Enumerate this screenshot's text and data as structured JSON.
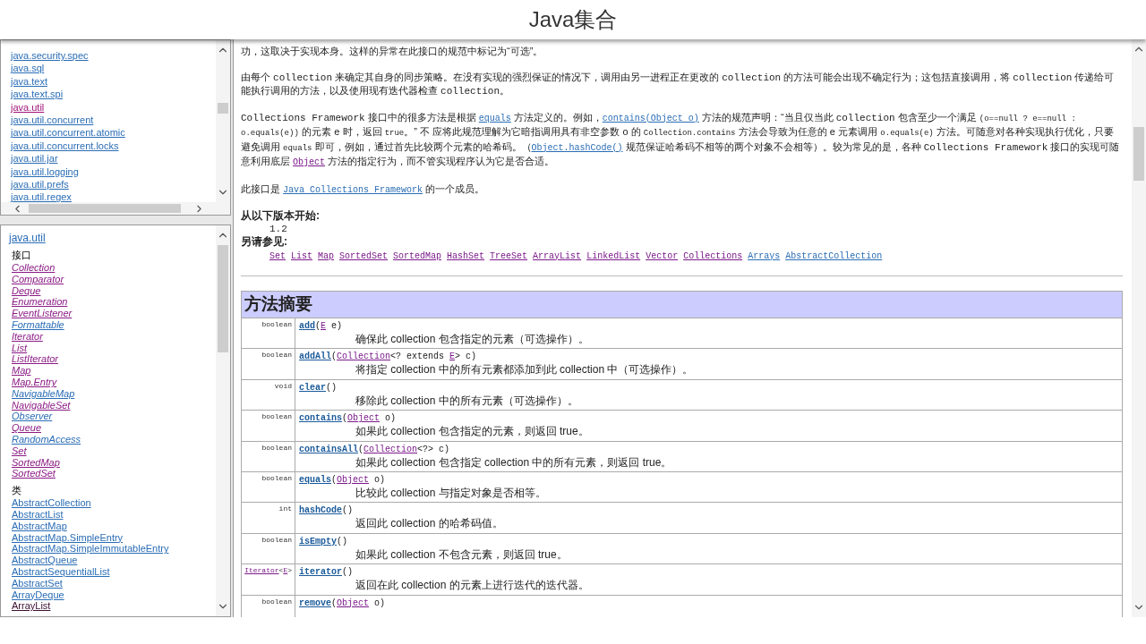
{
  "title": "Java集合",
  "packages": [
    {
      "label": "java.security.spec",
      "visited": false
    },
    {
      "label": "java.sql",
      "visited": false
    },
    {
      "label": "java.text",
      "visited": false
    },
    {
      "label": "java.text.spi",
      "visited": false
    },
    {
      "label": "java.util",
      "visited": true
    },
    {
      "label": "java.util.concurrent",
      "visited": false
    },
    {
      "label": "java.util.concurrent.atomic",
      "visited": false
    },
    {
      "label": "java.util.concurrent.locks",
      "visited": false
    },
    {
      "label": "java.util.jar",
      "visited": false
    },
    {
      "label": "java.util.logging",
      "visited": false
    },
    {
      "label": "java.util.prefs",
      "visited": false
    },
    {
      "label": "java.util.regex",
      "visited": false
    }
  ],
  "package_title": "java.util",
  "groups": [
    {
      "heading": "接口",
      "italic": true,
      "items": [
        {
          "label": "Collection",
          "visited": true
        },
        {
          "label": "Comparator",
          "visited": true
        },
        {
          "label": "Deque",
          "visited": true
        },
        {
          "label": "Enumeration",
          "visited": true
        },
        {
          "label": "EventListener",
          "visited": true
        },
        {
          "label": "Formattable",
          "visited": false
        },
        {
          "label": "Iterator",
          "visited": true
        },
        {
          "label": "List",
          "visited": true
        },
        {
          "label": "ListIterator",
          "visited": true
        },
        {
          "label": "Map",
          "visited": true
        },
        {
          "label": "Map.Entry",
          "visited": true
        },
        {
          "label": "NavigableMap",
          "visited": false
        },
        {
          "label": "NavigableSet",
          "visited": true
        },
        {
          "label": "Observer",
          "visited": false
        },
        {
          "label": "Queue",
          "visited": true
        },
        {
          "label": "RandomAccess",
          "visited": false
        },
        {
          "label": "Set",
          "visited": true
        },
        {
          "label": "SortedMap",
          "visited": true
        },
        {
          "label": "SortedSet",
          "visited": true
        }
      ]
    },
    {
      "heading": "类",
      "italic": false,
      "items": [
        {
          "label": "AbstractCollection",
          "visited": false
        },
        {
          "label": "AbstractList",
          "visited": false
        },
        {
          "label": "AbstractMap",
          "visited": false
        },
        {
          "label": "AbstractMap.SimpleEntry",
          "visited": false
        },
        {
          "label": "AbstractMap.SimpleImmutableEntry",
          "visited": false
        },
        {
          "label": "AbstractQueue",
          "visited": false
        },
        {
          "label": "AbstractSequentialList",
          "visited": false
        },
        {
          "label": "AbstractSet",
          "visited": false
        },
        {
          "label": "ArrayDeque",
          "visited": false
        },
        {
          "label": "ArrayList",
          "visited": true
        }
      ]
    }
  ],
  "paragraphs": [
    [
      {
        "kind": "text",
        "text": "功，这取决于实现本身。这样的异常在此接口的规范中标记为“可选”。"
      }
    ],
    [
      {
        "kind": "text",
        "text": "由每个 "
      },
      {
        "kind": "code",
        "text": "collection"
      },
      {
        "kind": "text",
        "text": " 来确定其自身的同步策略。在没有实现的强烈保证的情况下，调用由另一进程正在更改的 "
      },
      {
        "kind": "code",
        "text": "collection"
      },
      {
        "kind": "text",
        "text": " 的方法可能会出现不确定行为；这包括直接调用，将 "
      },
      {
        "kind": "code",
        "text": "collection"
      },
      {
        "kind": "text",
        "text": " 传递给可能执行调用的方法，以及使用现有迭代器检查 "
      },
      {
        "kind": "code",
        "text": "collection"
      },
      {
        "kind": "text",
        "text": "。"
      }
    ],
    [
      {
        "kind": "code",
        "text": "Collections Framework"
      },
      {
        "kind": "text",
        "text": " 接口中的很多方法是根据 "
      },
      {
        "kind": "link",
        "text": "equals"
      },
      {
        "kind": "text",
        "text": " 方法定义的。例如，"
      },
      {
        "kind": "link",
        "text": "contains(Object o)"
      },
      {
        "kind": "text",
        "text": " 方法的规范声明：“当且仅当此 "
      },
      {
        "kind": "code",
        "text": "collection"
      },
      {
        "kind": "text",
        "text": " 包含至少一个满足 "
      },
      {
        "kind": "small_code",
        "text": "(o==null ? e==null : o.equals(e))"
      },
      {
        "kind": "text",
        "text": " 的元素 "
      },
      {
        "kind": "code",
        "text": "e"
      },
      {
        "kind": "text",
        "text": " 时，返回 "
      },
      {
        "kind": "small_code",
        "text": "true"
      },
      {
        "kind": "text",
        "text": "。” 不 应将此规范理解为它暗指调用具有非空参数 "
      },
      {
        "kind": "code",
        "text": "o"
      },
      {
        "kind": "text",
        "text": " 的 "
      },
      {
        "kind": "small_code",
        "text": "Collection.contains"
      },
      {
        "kind": "text",
        "text": " 方法会导致为任意的 "
      },
      {
        "kind": "code",
        "text": "e"
      },
      {
        "kind": "text",
        "text": " 元素调用 "
      },
      {
        "kind": "small_code",
        "text": "o.equals(e)"
      },
      {
        "kind": "text",
        "text": " 方法。可随意对各种实现执行优化，只要避免调用 "
      },
      {
        "kind": "small_code",
        "text": "equals"
      },
      {
        "kind": "text",
        "text": " 即可，例如，通过首先比较两个元素的哈希码。（"
      },
      {
        "kind": "link",
        "text": "Object.hashCode()"
      },
      {
        "kind": "text",
        "text": " 规范保证哈希码不相等的两个对象不会相等）。较为常见的是，各种 "
      },
      {
        "kind": "code",
        "text": "Collections Framework"
      },
      {
        "kind": "text",
        "text": " 接口的实现可随意利用底层 "
      },
      {
        "kind": "visited_link",
        "text": "Object"
      },
      {
        "kind": "text",
        "text": " 方法的指定行为，而不管实现程序认为它是否合适。"
      }
    ],
    [
      {
        "kind": "text",
        "text": "此接口是 "
      },
      {
        "kind": "link",
        "text": "Java Collections Framework"
      },
      {
        "kind": "text",
        "text": " 的一个成员。"
      }
    ]
  ],
  "since": {
    "label": "从以下版本开始:",
    "value": "1.2"
  },
  "see_also": {
    "label": "另请参见:",
    "links": [
      {
        "label": "Set",
        "visited": true
      },
      {
        "label": "List",
        "visited": true
      },
      {
        "label": "Map",
        "visited": true
      },
      {
        "label": "SortedSet",
        "visited": true
      },
      {
        "label": "SortedMap",
        "visited": true
      },
      {
        "label": "HashSet",
        "visited": true
      },
      {
        "label": "TreeSet",
        "visited": true
      },
      {
        "label": "ArrayList",
        "visited": true
      },
      {
        "label": "LinkedList",
        "visited": true
      },
      {
        "label": "Vector",
        "visited": true
      },
      {
        "label": "Collections",
        "visited": true
      },
      {
        "label": "Arrays",
        "visited": false
      },
      {
        "label": "AbstractCollection",
        "visited": false
      }
    ]
  },
  "method_summary": {
    "heading": "方法摘要",
    "rows": [
      {
        "type": [
          {
            "kind": "text",
            "text": "boolean"
          }
        ],
        "name": "add",
        "params": [
          {
            "kind": "text",
            "text": "("
          },
          {
            "kind": "visited_link",
            "text": "E"
          },
          {
            "kind": "text",
            "text": " e)"
          }
        ],
        "description": "确保此 collection 包含指定的元素（可选操作）。"
      },
      {
        "type": [
          {
            "kind": "text",
            "text": "boolean"
          }
        ],
        "name": "addAll",
        "params": [
          {
            "kind": "text",
            "text": "("
          },
          {
            "kind": "visited_link",
            "text": "Collection"
          },
          {
            "kind": "text",
            "text": "<? extends "
          },
          {
            "kind": "visited_link",
            "text": "E"
          },
          {
            "kind": "text",
            "text": "> c)"
          }
        ],
        "description": "将指定 collection 中的所有元素都添加到此 collection 中（可选操作）。"
      },
      {
        "type": [
          {
            "kind": "text",
            "text": "void"
          }
        ],
        "name": "clear",
        "params": [
          {
            "kind": "text",
            "text": "()"
          }
        ],
        "description": "移除此 collection 中的所有元素（可选操作）。"
      },
      {
        "type": [
          {
            "kind": "text",
            "text": "boolean"
          }
        ],
        "name": "contains",
        "params": [
          {
            "kind": "text",
            "text": "("
          },
          {
            "kind": "visited_link",
            "text": "Object"
          },
          {
            "kind": "text",
            "text": " o)"
          }
        ],
        "description": "如果此 collection 包含指定的元素，则返回 true。"
      },
      {
        "type": [
          {
            "kind": "text",
            "text": "boolean"
          }
        ],
        "name": "containsAll",
        "params": [
          {
            "kind": "text",
            "text": "("
          },
          {
            "kind": "visited_link",
            "text": "Collection"
          },
          {
            "kind": "text",
            "text": "<?> c)"
          }
        ],
        "description": "如果此 collection 包含指定 collection 中的所有元素，则返回 true。"
      },
      {
        "type": [
          {
            "kind": "text",
            "text": "boolean"
          }
        ],
        "name": "equals",
        "params": [
          {
            "kind": "text",
            "text": "("
          },
          {
            "kind": "visited_link",
            "text": "Object"
          },
          {
            "kind": "text",
            "text": " o)"
          }
        ],
        "description": "比较此 collection 与指定对象是否相等。"
      },
      {
        "type": [
          {
            "kind": "text",
            "text": "int"
          }
        ],
        "name": "hashCode",
        "params": [
          {
            "kind": "text",
            "text": "()"
          }
        ],
        "description": "返回此 collection 的哈希码值。"
      },
      {
        "type": [
          {
            "kind": "text",
            "text": "boolean"
          }
        ],
        "name": "isEmpty",
        "params": [
          {
            "kind": "text",
            "text": "()"
          }
        ],
        "description": "如果此 collection 不包含元素，则返回 true。"
      },
      {
        "type": [
          {
            "kind": "visited_link",
            "text": "Iterator"
          },
          {
            "kind": "text",
            "text": "<"
          },
          {
            "kind": "visited_link",
            "text": "E"
          },
          {
            "kind": "text",
            "text": ">"
          }
        ],
        "name": "iterator",
        "params": [
          {
            "kind": "text",
            "text": "()"
          }
        ],
        "description": "返回在此 collection 的元素上进行迭代的迭代器。"
      },
      {
        "type": [
          {
            "kind": "text",
            "text": "boolean"
          }
        ],
        "name": "remove",
        "params": [
          {
            "kind": "text",
            "text": "("
          },
          {
            "kind": "visited_link",
            "text": "Object"
          },
          {
            "kind": "text",
            "text": " o)"
          }
        ]
      }
    ]
  }
}
